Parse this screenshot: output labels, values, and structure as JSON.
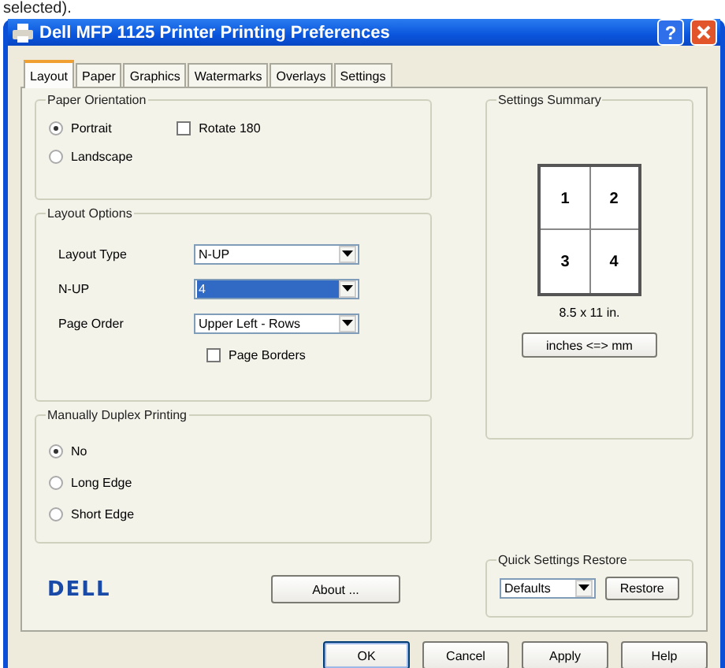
{
  "caption": "selected).",
  "window": {
    "title": "Dell MFP 1125 Printer Printing Preferences",
    "help": "?"
  },
  "tabs": [
    {
      "label": "Layout",
      "selected": true
    },
    {
      "label": "Paper",
      "selected": false
    },
    {
      "label": "Graphics",
      "selected": false
    },
    {
      "label": "Watermarks",
      "selected": false
    },
    {
      "label": "Overlays",
      "selected": false
    },
    {
      "label": "Settings",
      "selected": false
    }
  ],
  "paper_orientation": {
    "title": "Paper Orientation",
    "options": [
      {
        "label": "Portrait",
        "selected": true
      },
      {
        "label": "Landscape",
        "selected": false
      }
    ],
    "rotate": {
      "label": "Rotate 180",
      "checked": false
    }
  },
  "layout_options": {
    "title": "Layout Options",
    "fields": [
      {
        "label": "Layout Type",
        "value": "N-UP",
        "highlighted": false
      },
      {
        "label": "N-UP",
        "value": "4",
        "highlighted": true
      },
      {
        "label": "Page Order",
        "value": "Upper Left - Rows",
        "highlighted": false
      }
    ],
    "page_borders": {
      "label": "Page Borders",
      "checked": false
    }
  },
  "duplex": {
    "title": "Manually Duplex Printing",
    "options": [
      {
        "label": "No",
        "selected": true
      },
      {
        "label": "Long Edge",
        "selected": false
      },
      {
        "label": "Short Edge",
        "selected": false
      }
    ]
  },
  "logo": "DELL",
  "about_button": "About ...",
  "settings_summary": {
    "title": "Settings Summary",
    "pages": [
      "1",
      "2",
      "3",
      "4"
    ],
    "size": "8.5 x 11 in.",
    "units_button": "inches <=> mm"
  },
  "quick_restore": {
    "title": "Quick Settings Restore",
    "value": "Defaults",
    "button": "Restore"
  },
  "buttons": [
    "OK",
    "Cancel",
    "Apply",
    "Help"
  ]
}
